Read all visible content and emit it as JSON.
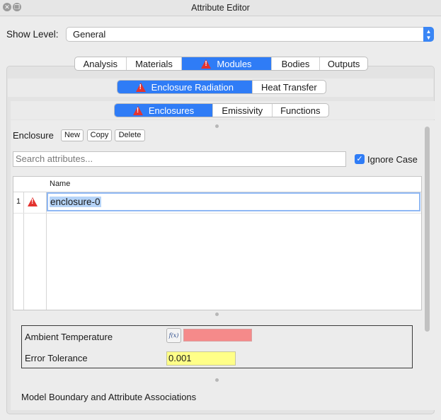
{
  "window": {
    "title": "Attribute Editor",
    "close_glyph": "✕",
    "restore_glyph": "❐"
  },
  "show_level": {
    "label": "Show Level:",
    "value": "General",
    "stepper_up": "▲",
    "stepper_down": "▼"
  },
  "main_tabs": [
    {
      "label": "Analysis",
      "active": false,
      "warning": false
    },
    {
      "label": "Materials",
      "active": false,
      "warning": false
    },
    {
      "label": "Modules",
      "active": true,
      "warning": true
    },
    {
      "label": "Bodies",
      "active": false,
      "warning": false
    },
    {
      "label": "Outputs",
      "active": false,
      "warning": false
    }
  ],
  "module_tabs": [
    {
      "label": "Enclosure Radiation",
      "active": true,
      "warning": true
    },
    {
      "label": "Heat Transfer",
      "active": false,
      "warning": false
    }
  ],
  "sub_tabs": [
    {
      "label": "Enclosures",
      "active": true,
      "warning": true
    },
    {
      "label": "Emissivity",
      "active": false,
      "warning": false
    },
    {
      "label": "Functions",
      "active": false,
      "warning": false
    }
  ],
  "enclosure": {
    "label": "Enclosure",
    "new_label": "New",
    "copy_label": "Copy",
    "delete_label": "Delete"
  },
  "search": {
    "placeholder": "Search attributes...",
    "ignore_case_label": "Ignore Case",
    "ignore_case_checked": true,
    "check_glyph": "✓"
  },
  "table": {
    "columns": [
      "Name"
    ],
    "rows": [
      {
        "number": "1",
        "name": "enclosure-0",
        "status": "warning-icon"
      }
    ]
  },
  "attributes": {
    "ambient_label": "Ambient Temperature",
    "fx_label": "f(x)",
    "ambient_value": "",
    "ambient_color": "#f58a8a",
    "error_label": "Error Tolerance",
    "error_value": "0.001",
    "error_color": "#ffff88"
  },
  "associations_label": "Model Boundary and Attribute Associations",
  "colors": {
    "accent": "#2f7cf6",
    "warning": "#e3332f"
  }
}
